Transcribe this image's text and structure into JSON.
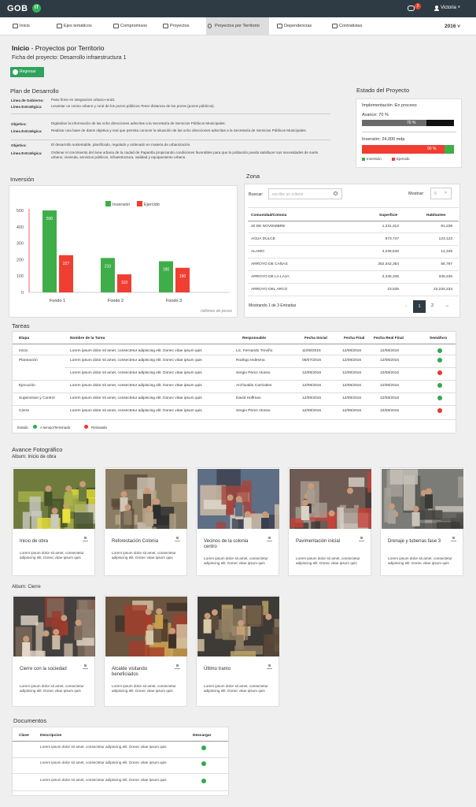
{
  "header": {
    "logo": "GOB",
    "logo_badge": "IT",
    "notifications": "2",
    "user": "Victoria ˅"
  },
  "nav": {
    "items": [
      "Inicio",
      "Ejes temáticos",
      "Compromisos",
      "Proyectos",
      "Proyectos por Territorio",
      "Dependencias",
      "Contratistas"
    ],
    "year": "2016 ˅"
  },
  "page": {
    "breadcrumb_home": "Inicio",
    "breadcrumb_rest": " - Proyectos por Territorio",
    "ficha": "Ficha del proyecto:  Desarrollo infraestructura 1",
    "back": "Regresar"
  },
  "plan": {
    "title": "Plan de Desarrollo",
    "rows": [
      {
        "label": "Línea de Gobierno:",
        "text": "Paso firme en integracion urbano-rural1"
      },
      {
        "label": "Línea Estratégica:",
        "text": "Levantar un censo urbano y rural de los pozos públicos.Tener distancia de los pozos (pozos públicos)."
      },
      {
        "label": "Objetivo:",
        "text": "Digitalizar la información de las ocho direcciones adscritas a la Secretaría de Servicios Públicos Municipales."
      },
      {
        "label": "Línea Estratégica:",
        "text": "Realizar una base de datos objetiva y real que permita conocer la situación de las ocho direcciones adscritas a la Secretaría de Servicios Públicos Municipales."
      },
      {
        "label": "Objetivo:",
        "text": "El desarrollo sustentable, planificado, regulado y ordenado en materia de urbanización."
      },
      {
        "label": "Línea Estratégica:",
        "text": "Ordenar el crecimiento del área urbana de la ciudad de Papantla propiciando condiciones favorables para que la población pueda satisfacer sus necesidades de suelo urbano, vivienda, servicios públicos, infraestructura, vialidad y equipamiento urbano."
      }
    ]
  },
  "estado": {
    "title": "Estado del Proyecto",
    "implementacion": "Implementación :En proceso",
    "avance": "Avance: 70 %",
    "avance_label": "70 %",
    "avance_value": 0.7,
    "inversion": "Inversión: 24,000 mdp",
    "inversion_label": "90 %",
    "inversion_value": 0.9,
    "legend_inv": "Inversión",
    "legend_ej": "Ejercido"
  },
  "inversion_title": "Inversión",
  "chart_data": {
    "type": "bar",
    "categories": [
      "Fondo 1",
      "Fondo 2",
      "Fondo 3"
    ],
    "series": [
      {
        "name": "Inversión",
        "values": [
          500,
          210,
          190
        ],
        "color": "#3fae49"
      },
      {
        "name": "Ejercido",
        "values": [
          227,
          110,
          150
        ],
        "color": "#f03e33"
      }
    ],
    "ylim": [
      0,
      500
    ],
    "yticks": [
      "0",
      "100",
      "200",
      "300",
      "400",
      "500"
    ],
    "xlabel": "millones de pesos",
    "legend": "top"
  },
  "zona": {
    "title": "Zona",
    "search_label": "Buscar:",
    "search_placeholder": "escribe un criterio",
    "show_label": "Mostrar:",
    "show_value": "6",
    "headers": [
      "Comunidad/Colonia",
      "Superficie",
      "Habitantes"
    ],
    "rows": [
      [
        "20 DE NOVIEMBRE",
        "1,231,312",
        "91,238"
      ],
      [
        "AGUA DULCE",
        "673,747",
        "123,123"
      ],
      [
        "ALAMO",
        "4,236,546",
        "12,345"
      ],
      [
        "ARROYO DE CAÑAS",
        "252,342,354",
        "56,787"
      ],
      [
        "ARROYO DE LA LAJA",
        "2,345,345",
        "345,436"
      ],
      [
        "ARROYO DEL ARCO",
        "23,535",
        "23,234,234"
      ]
    ],
    "info": "Mostrando 1 de 3 Entradas",
    "pages": [
      "←",
      "1",
      "2",
      "→"
    ]
  },
  "tareas": {
    "title": "Tareas",
    "headers": [
      "Etapa",
      "Nombre de la Tarea",
      "Responsable",
      "Fecha Inicial",
      "Fecha Final",
      "Fecha Real Final",
      "Semáforo"
    ],
    "rows": [
      {
        "etapa": "Inicio",
        "nombre": "Lorem ipsum dolor sit amet, consectetur adipiscing elit. Donec vitae ipsum quis",
        "resp": "Lic. Fernando Treviño",
        "fi": "11/08/2016",
        "ff": "12/08/2016",
        "fr": "12/08/2016",
        "status": "green"
      },
      {
        "etapa": "Planeación",
        "nombre": "Lorem ipsum dolor sit amet, consectetur adipiscing elit. Donec vitae ipsum quis",
        "resp": "Rodrigo Iedesma",
        "fi": "06/07/2016",
        "ff": "12/08/2016",
        "fr": "12/08/2016",
        "status": "green"
      },
      {
        "etapa": "",
        "nombre": "Lorem ipsum dolor sit amet, consectetur adipiscing elit. Donec vitae ipsum quis",
        "resp": "Sergio Perez Alonso",
        "fi": "12/08/2016",
        "ff": "12/08/2016",
        "fr": "12/08/2016",
        "status": "red"
      },
      {
        "etapa": "Ejecución",
        "nombre": "Lorem ipsum dolor sit amet, consectetur adipiscing elit. Donec vitae ipsum quis",
        "resp": "Archivaldo Carrizales",
        "fi": "12/08/2016",
        "ff": "12/08/2016",
        "fr": "12/08/2016",
        "status": "green"
      },
      {
        "etapa": "Supervision y Control",
        "nombre": "Lorem ipsum dolor sit amet, consectetur adipiscing elit. Donec vitae ipsum quis",
        "resp": "David Hoffman",
        "fi": "12/08/2016",
        "ff": "12/08/2016",
        "fr": "12/08/2016",
        "status": "green"
      },
      {
        "etapa": "Cierre",
        "nombre": "Lorem ipsum dolor sit amet, consectetur adipiscing elit. Donec vitae ipsum quis",
        "resp": "Sergio Perez Alonso",
        "fi": "12/08/2016",
        "ff": "12/08/2016",
        "fr": "12/08/2016",
        "status": "red"
      }
    ],
    "legend_label": "Estado:",
    "legend_ok": "A tiempo/Terminada",
    "legend_late": "Retrasada"
  },
  "avance": {
    "title": "Avance Fotográfico",
    "album1": "Album: Inicio de obra",
    "album2": "Album: Cierre",
    "desc": "Lorem ipsum dolor sit amet, consectetur adipiscing elit. Donec vitae ipsum quis",
    "photos1": [
      "Inicio de obra",
      "Reforestación Colonia",
      "Vecinos de la colonia centro",
      "Pavimentación inicial",
      "Drenaje y tuberías fase 3"
    ],
    "photos2": [
      "Cierre con la sociedad",
      "Alcalde visitando beneficiados",
      "Último tramo"
    ]
  },
  "docs": {
    "title": "Documentos",
    "headers": [
      "Clave",
      "Descripcion",
      "Descargar"
    ],
    "desc": "Lorem ipsum dolor sit amet, consectetur adipiscing elit. Donec vitae ipsum quis"
  },
  "colors": {
    "green": "#2fa35d",
    "red": "#e8352f",
    "dark": "#2e3b44"
  }
}
